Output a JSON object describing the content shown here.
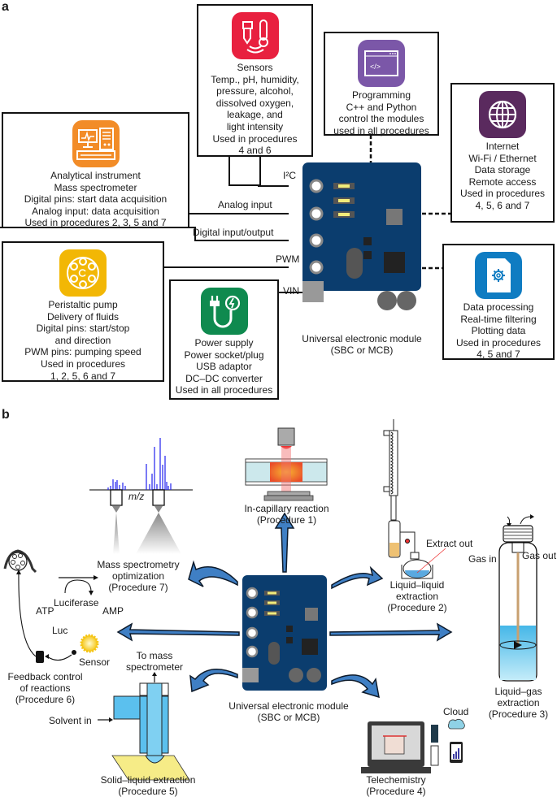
{
  "panel_a": {
    "letter": "a",
    "boxes": {
      "sensors": {
        "icon": "sensor-thermometer-icon",
        "color": "#e8203f",
        "lines": [
          "Sensors",
          "Temp., pH, humidity,",
          "pressure, alcohol,",
          "dissolved oxygen,",
          "leakage, and",
          "light intensity",
          "Used in procedures",
          "4 and 6"
        ]
      },
      "programming": {
        "icon": "code-window-icon",
        "color": "#7b57a8",
        "lines": [
          "Programming",
          "C++ and Python",
          "control the modules",
          "used in all procedures"
        ]
      },
      "internet": {
        "icon": "globe-icon",
        "color": "#5a2a5e",
        "lines": [
          "Internet",
          "Wi-Fi / Ethernet",
          "Data storage",
          "Remote access",
          "Used in procedures",
          "4, 5, 6 and 7"
        ]
      },
      "analytical": {
        "icon": "analytical-instrument-icon",
        "color": "#f28c28",
        "lines": [
          "Analytical instrument",
          "Mass spectrometer",
          "Digital pins: start data acquisition",
          "Analog input: data acquisition",
          "Used in procedures 2, 3, 5 and 7"
        ]
      },
      "pump": {
        "icon": "peristaltic-pump-icon",
        "color": "#f2b705",
        "lines": [
          "Peristaltic pump",
          "Delivery of fluids",
          "Digital pins: start/stop",
          "and direction",
          "PWM pins: pumping speed",
          "Used in procedures",
          "1, 2, 5, 6 and 7"
        ]
      },
      "power": {
        "icon": "power-plug-icon",
        "color": "#0f8a4f",
        "lines": [
          "Power supply",
          "Power socket/plug",
          "USB adaptor",
          "DC–DC converter",
          "Used in all procedures"
        ]
      },
      "data_processing": {
        "icon": "data-file-gear-icon",
        "color": "#0f7cc2",
        "lines": [
          "Data processing",
          "Real-time filtering",
          "Plotting data",
          "Used in procedures",
          "4, 5 and 7"
        ]
      }
    },
    "pins": {
      "i2c": "I²C",
      "analog": "Analog input",
      "digital": "Digital input/output",
      "pwm": "PWM",
      "vin": "VIN"
    },
    "module_caption": [
      "Universal electronic module",
      "(SBC or MCB)"
    ],
    "board_color": "#0b3d6e"
  },
  "panel_b": {
    "letter": "b",
    "module_caption": [
      "Universal electronic module",
      "(SBC or MCB)"
    ],
    "arrow_color": "#3f7fc4",
    "procedures": {
      "p1": [
        "In-capillary reaction",
        "(Procedure 1)"
      ],
      "p2": [
        "Liquid–liquid",
        "extraction",
        "(Procedure 2)"
      ],
      "p3": [
        "Liquid–gas",
        "extraction",
        "(Procedure 3)"
      ],
      "p4": [
        "Telechemistry",
        "(Procedure 4)"
      ],
      "p5": [
        "Solid–liquid extraction",
        "(Procedure 5)"
      ],
      "p6": [
        "Feedback control",
        "of reactions",
        "(Procedure 6)"
      ],
      "p7": [
        "Mass spectrometry",
        "optimization",
        "(Procedure 7)"
      ]
    },
    "annotations": {
      "mz": "m/z",
      "extract_out": "Extract out",
      "gas_in": "Gas in",
      "gas_out": "Gas out",
      "cloud": "Cloud",
      "to_ms": [
        "To mass",
        "spectrometer"
      ],
      "solvent_in": "Solvent in",
      "luciferase": "Luciferase",
      "atp": "ATP",
      "amp": "AMP",
      "luc": "Luc",
      "sensor": "Sensor"
    }
  }
}
